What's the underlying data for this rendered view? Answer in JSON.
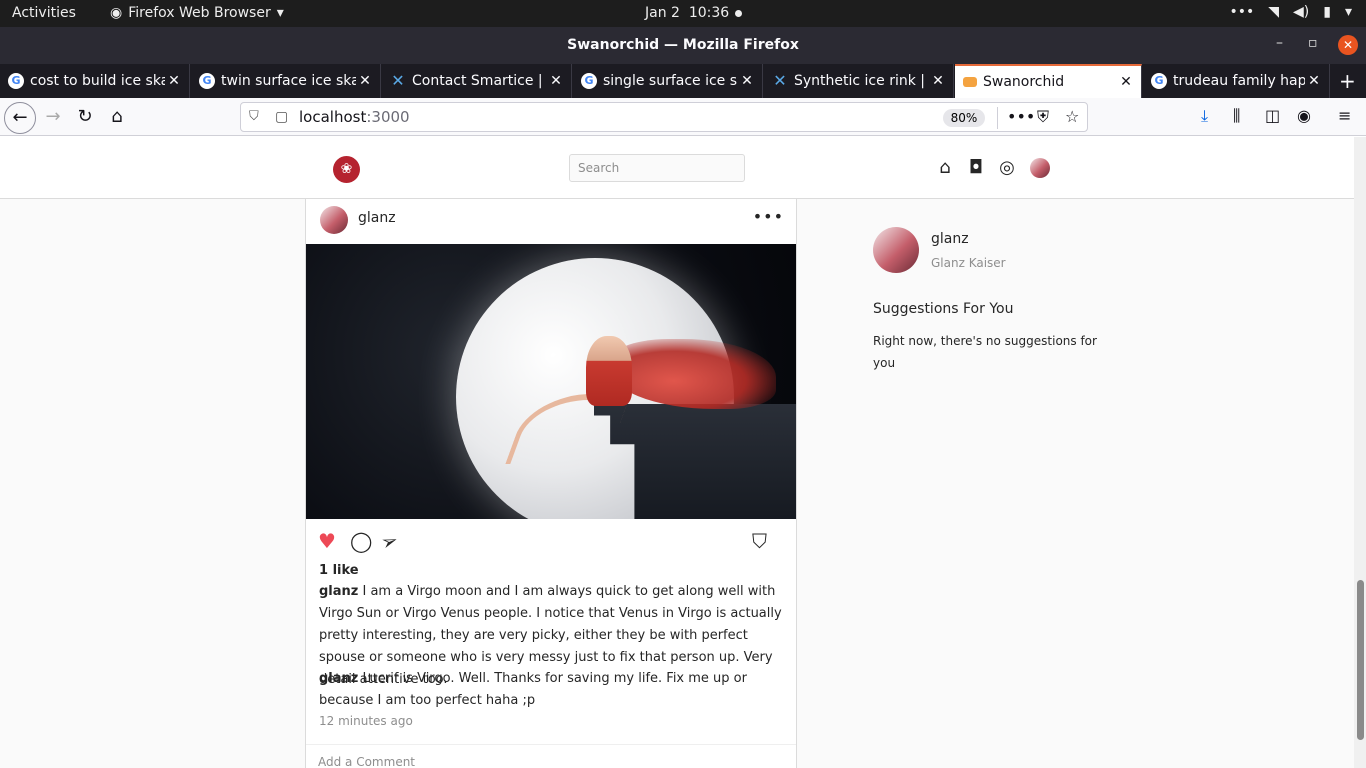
{
  "os_bar": {
    "activities": "Activities",
    "app_menu": "Firefox Web Browser",
    "date": "Jan 2",
    "time": "10:36"
  },
  "window": {
    "title": "Swanorchid — Mozilla Firefox"
  },
  "tabs": [
    {
      "label": "cost to build ice ska",
      "icon": "google-icon"
    },
    {
      "label": "twin surface ice ska",
      "icon": "google-icon"
    },
    {
      "label": "Contact Smartice | A",
      "icon": "x-icon"
    },
    {
      "label": "single surface ice sk",
      "icon": "google-icon"
    },
    {
      "label": "Synthetic ice rink | X",
      "icon": "x-icon"
    },
    {
      "label": "Swanorchid",
      "icon": "swanorchid-icon",
      "active": true
    },
    {
      "label": "trudeau family happ",
      "icon": "google-icon"
    }
  ],
  "navbar": {
    "url_host": "localhost",
    "url_port": ":3000",
    "zoom": "80%"
  },
  "site": {
    "search_placeholder": "Search"
  },
  "post": {
    "username": "glanz",
    "likes": "1 like",
    "comments": [
      {
        "user": "glanz",
        "text": "I am a Virgo moon and I am always quick to get along well with Virgo Sun or Virgo Venus people. I notice that Venus in Virgo is actually pretty interesting, they are very picky, either they be with perfect spouse or someone who is very messy just to fix that person up. Very detail attentive too."
      },
      {
        "user": "glanz",
        "text": "Lucrif is Virgo. Well. Thanks for saving my life. Fix me up or because I am too perfect haha ;p"
      }
    ],
    "time_ago": "12 minutes ago",
    "comment_placeholder": "Add a Comment",
    "liked": true,
    "like_color": "#ed4956"
  },
  "sidebar": {
    "username": "glanz",
    "fullname": "Glanz Kaiser",
    "suggestions_title": "Suggestions For You",
    "no_suggestions": "Right now, there's no suggestions for you"
  }
}
